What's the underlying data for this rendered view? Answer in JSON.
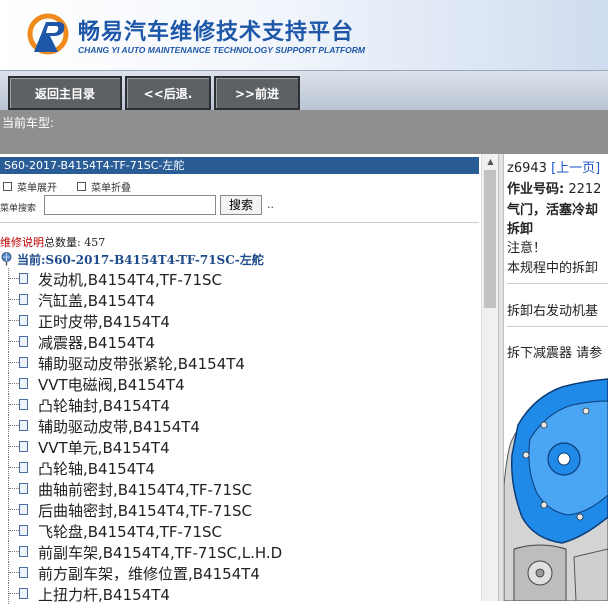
{
  "header": {
    "title_cn": "畅易汽车维修技术支持平台",
    "title_en": "CHANG YI AUTO MAINTENANCE TECHNOLOGY SUPPORT PLATFORM",
    "logo_icon": "cy-logo-icon"
  },
  "nav": {
    "home_label": "返回主目录",
    "back_label": "<<后退.",
    "forward_label": ">>前进"
  },
  "vehicle": {
    "label": "当前车型:"
  },
  "left_panel": {
    "title": "S60-2017-B4154T4-TF-71SC-左舵",
    "expand_label": "菜单展开",
    "collapse_label": "菜单折叠",
    "search_label": "菜单搜索",
    "search_value": "",
    "search_button": "搜索",
    "search_suffix": "..",
    "count_red": "维修说明",
    "count_text": "总数量: 457",
    "root_label": "当前:S60-2017-B4154T4-TF-71SC-左舵",
    "items": [
      {
        "label": "发动机,B4154T4,TF-71SC"
      },
      {
        "label": "汽缸盖,B4154T4"
      },
      {
        "label": "正时皮带,B4154T4"
      },
      {
        "label": "减震器,B4154T4"
      },
      {
        "label": "辅助驱动皮带张紧轮,B4154T4"
      },
      {
        "label": "VVT电磁阀,B4154T4"
      },
      {
        "label": "凸轮轴封,B4154T4"
      },
      {
        "label": "辅助驱动皮带,B4154T4"
      },
      {
        "label": "VVT单元,B4154T4"
      },
      {
        "label": "凸轮轴,B4154T4"
      },
      {
        "label": "曲轴前密封,B4154T4,TF-71SC"
      },
      {
        "label": "后曲轴密封,B4154T4,TF-71SC"
      },
      {
        "label": "飞轮盘,B4154T4,TF-71SC"
      },
      {
        "label": "前副车架,B4154T4,TF-71SC,L.H.D"
      },
      {
        "label": "前方副车架，维修位置,B4154T4"
      },
      {
        "label": "上扭力杆,B4154T4"
      }
    ]
  },
  "right_panel": {
    "doc_id": "z6943",
    "prev_link": "[上一页]",
    "job_label": "作业号码:",
    "job_value": "2212",
    "line_bold_1": "气门，活塞冷却",
    "line_bold_2": "拆卸",
    "note": "注意！",
    "note_text": "本规程中的拆卸",
    "step1": "拆卸右发动机基",
    "step2": "拆下减震器 请参"
  },
  "colors": {
    "brand_blue": "#1e57a8",
    "title_bar": "#2a5d96",
    "nav_button": "#5d6165",
    "vehicle_bar": "#8f8f8f",
    "link": "#1e57c8",
    "count_red": "#c00000",
    "engine_blue": "#1f8ae8"
  }
}
